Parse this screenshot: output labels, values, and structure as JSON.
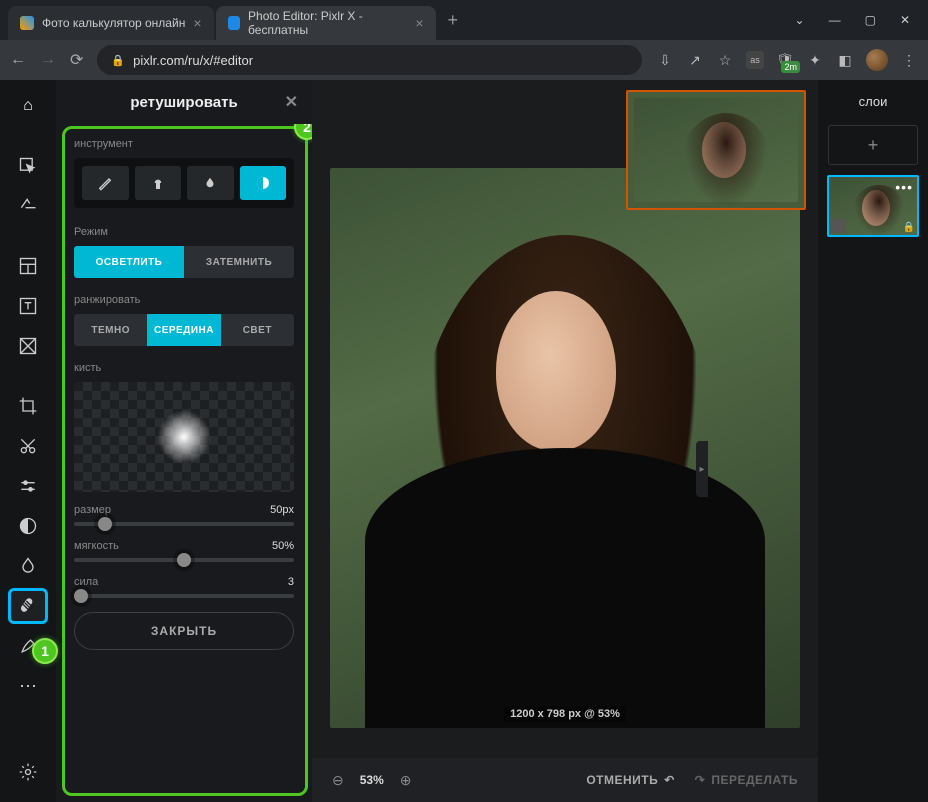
{
  "browser": {
    "tabs": [
      {
        "label": "Фото калькулятор онлайн"
      },
      {
        "label": "Photo Editor: Pixlr X - бесплатны"
      }
    ],
    "url": "pixlr.com/ru/x/#editor",
    "ext_badge": "2m"
  },
  "panel": {
    "title": "ретушировать",
    "instrument_label": "инструмент",
    "mode_label": "Режим",
    "mode": {
      "lighten": "ОСВЕТЛИТЬ",
      "darken": "ЗАТЕМНИТЬ"
    },
    "range_label": "ранжировать",
    "range": {
      "dark": "ТЕМНО",
      "mid": "СЕРЕДИНА",
      "light": "СВЕТ"
    },
    "brush_label": "кисть",
    "size": {
      "label": "размер",
      "value": "50px",
      "pct": 14
    },
    "soft": {
      "label": "мягкость",
      "value": "50%",
      "pct": 50
    },
    "strength": {
      "label": "сила",
      "value": "3",
      "pct": 3
    },
    "close": "ЗАКРЫТЬ"
  },
  "canvas": {
    "dim": "1200 x 798 px @ 53%"
  },
  "bottombar": {
    "zoom": "53%",
    "undo": "ОТМЕНИТЬ",
    "redo": "ПЕРЕДЕЛАТЬ"
  },
  "layers": {
    "title": "слои"
  },
  "badges": {
    "one": "1",
    "two": "2"
  }
}
